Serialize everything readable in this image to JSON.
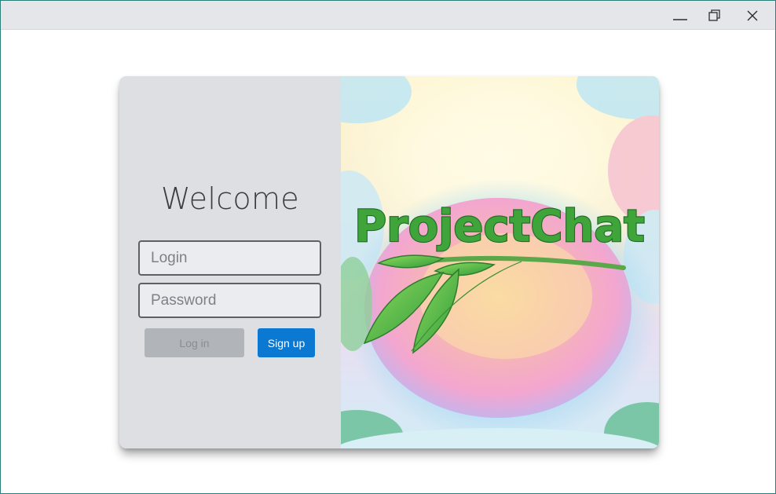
{
  "window": {
    "controls": {
      "minimize_icon": "minimize-icon",
      "maximize_icon": "restore-icon",
      "close_icon": "close-icon"
    }
  },
  "auth": {
    "heading": "Welcome",
    "login_placeholder": "Login",
    "password_placeholder": "Password",
    "login_button": "Log in",
    "signup_button": "Sign up"
  },
  "brand": {
    "logo_text": "ProjectChat"
  },
  "colors": {
    "accent": "#0b78d2",
    "disabled_button": "#b1b4b9",
    "panel": "#dedfe3",
    "logo_green": "#3fa43a"
  }
}
